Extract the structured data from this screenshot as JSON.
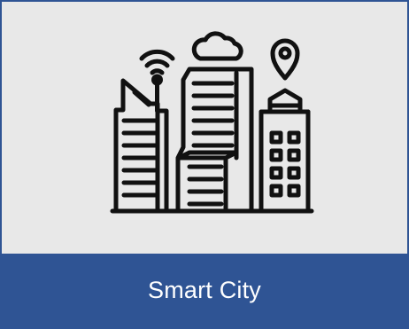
{
  "card": {
    "title": "Smart City",
    "icon": "smart-city-icon",
    "colors": {
      "accent": "#2f5494",
      "background": "#e8e8e8",
      "ink": "#111111",
      "label": "#ffffff"
    }
  }
}
